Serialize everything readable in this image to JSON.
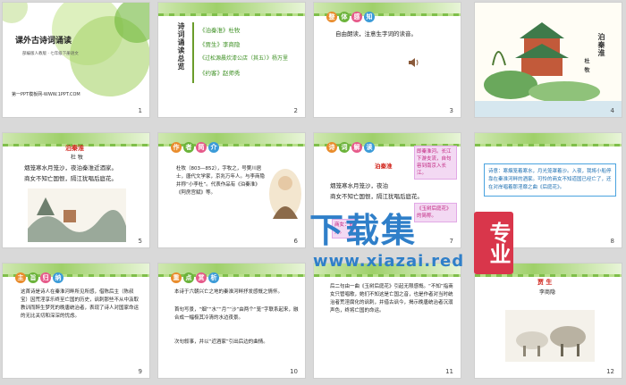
{
  "slides": [
    {
      "num": "1",
      "title": "课外古诗词诵读",
      "subtitle": "部编版人教版 · 七年级下册语文",
      "footer": "第一PPT模板网-WWW.1PPT.COM"
    },
    {
      "num": "2",
      "vertical_title": "诗词诵读总览",
      "items": [
        "《泊秦淮》杜牧",
        "《贾生》李商隐",
        "《过松源晨炊漆公店（其五）》杨万里",
        "《约客》赵师秀"
      ]
    },
    {
      "num": "3",
      "tag": [
        "整",
        "体",
        "感",
        "知"
      ],
      "line": "自由朗读，注意生字词的读音。"
    },
    {
      "num": "4",
      "vertical_title": "泊秦淮",
      "author": "杜 牧"
    },
    {
      "num": "5",
      "title": "泊秦淮",
      "author": "杜 牧",
      "lines": [
        "烟笼寒水月笼沙，夜泊秦淮近酒家。",
        "商女不知亡国恨，隔江犹唱后庭花。"
      ]
    },
    {
      "num": "6",
      "tag": [
        "作",
        "者",
        "简",
        "介"
      ],
      "text": "杜牧（803—852），字牧之，号樊川居士，唐代文学家，京兆万年人。与李商隐并称“小李杜”。代表作品有《泊秦淮》《阿房宫赋》等。"
    },
    {
      "num": "7",
      "tag": [
        "诗",
        "词",
        "解",
        "读"
      ],
      "title": "泊秦淮",
      "lines": [
        "烟笼寒水月笼沙，夜泊",
        "商女不知亡国恨，隔江犹唱后庭花。"
      ],
      "notes": [
        "即秦淮河。长江下游支流，自句容到南京入长江。",
        "商女：歌女。",
        "《玉树后庭花》的简称。"
      ]
    },
    {
      "num": "8",
      "text": "诗意：寒烟笼着寒水，月光笼罩着沙。入夜，我将小船停靠在秦淮河畔的酒家。可怜的商女不知道国已经亡了，还在对岸唱着那淫靡之曲《后庭花》。"
    },
    {
      "num": "9",
      "tag": [
        "主",
        "旨",
        "归",
        "纳"
      ],
      "text": "这首诗是诗人在秦淮河畔所见所感，借陈后主（陈叔宝）因荒淫享乐终至亡国的历史，讽刺那些不从中汲取教训而醉生梦死的晚唐统治者，表现了诗人对国家命运的无比关切和深深的忧虑。"
    },
    {
      "num": "10",
      "tag": [
        "重",
        "点",
        "赏",
        "析"
      ],
      "intro": "本诗于六朝兴亡之地的秦淮河畔抒发感慨之情怀。",
      "points": [
        "首句写景，“烟”“水”“月”“沙”由两个“笼”字联系起来，融合成一幅极其冷清的水边夜景。",
        "次句叙事，并以“近酒家”引出后边的曲情。"
      ]
    },
    {
      "num": "11",
      "text": "后二句由一曲《玉树后庭花》引起无限感慨。“不知”指商女只管唱歌，她们不知这是亡国之音，也是作者对当时统治者荒淫腐化的讽刺，并借古讽今，揭示晚唐统治者沉溺声色，终将亡国的命运。"
    },
    {
      "num": "12",
      "title": "贾 生",
      "author": "李商隐"
    }
  ],
  "watermark": {
    "big": "下载集",
    "badge": "专业",
    "url": "www.xiazai.red"
  }
}
